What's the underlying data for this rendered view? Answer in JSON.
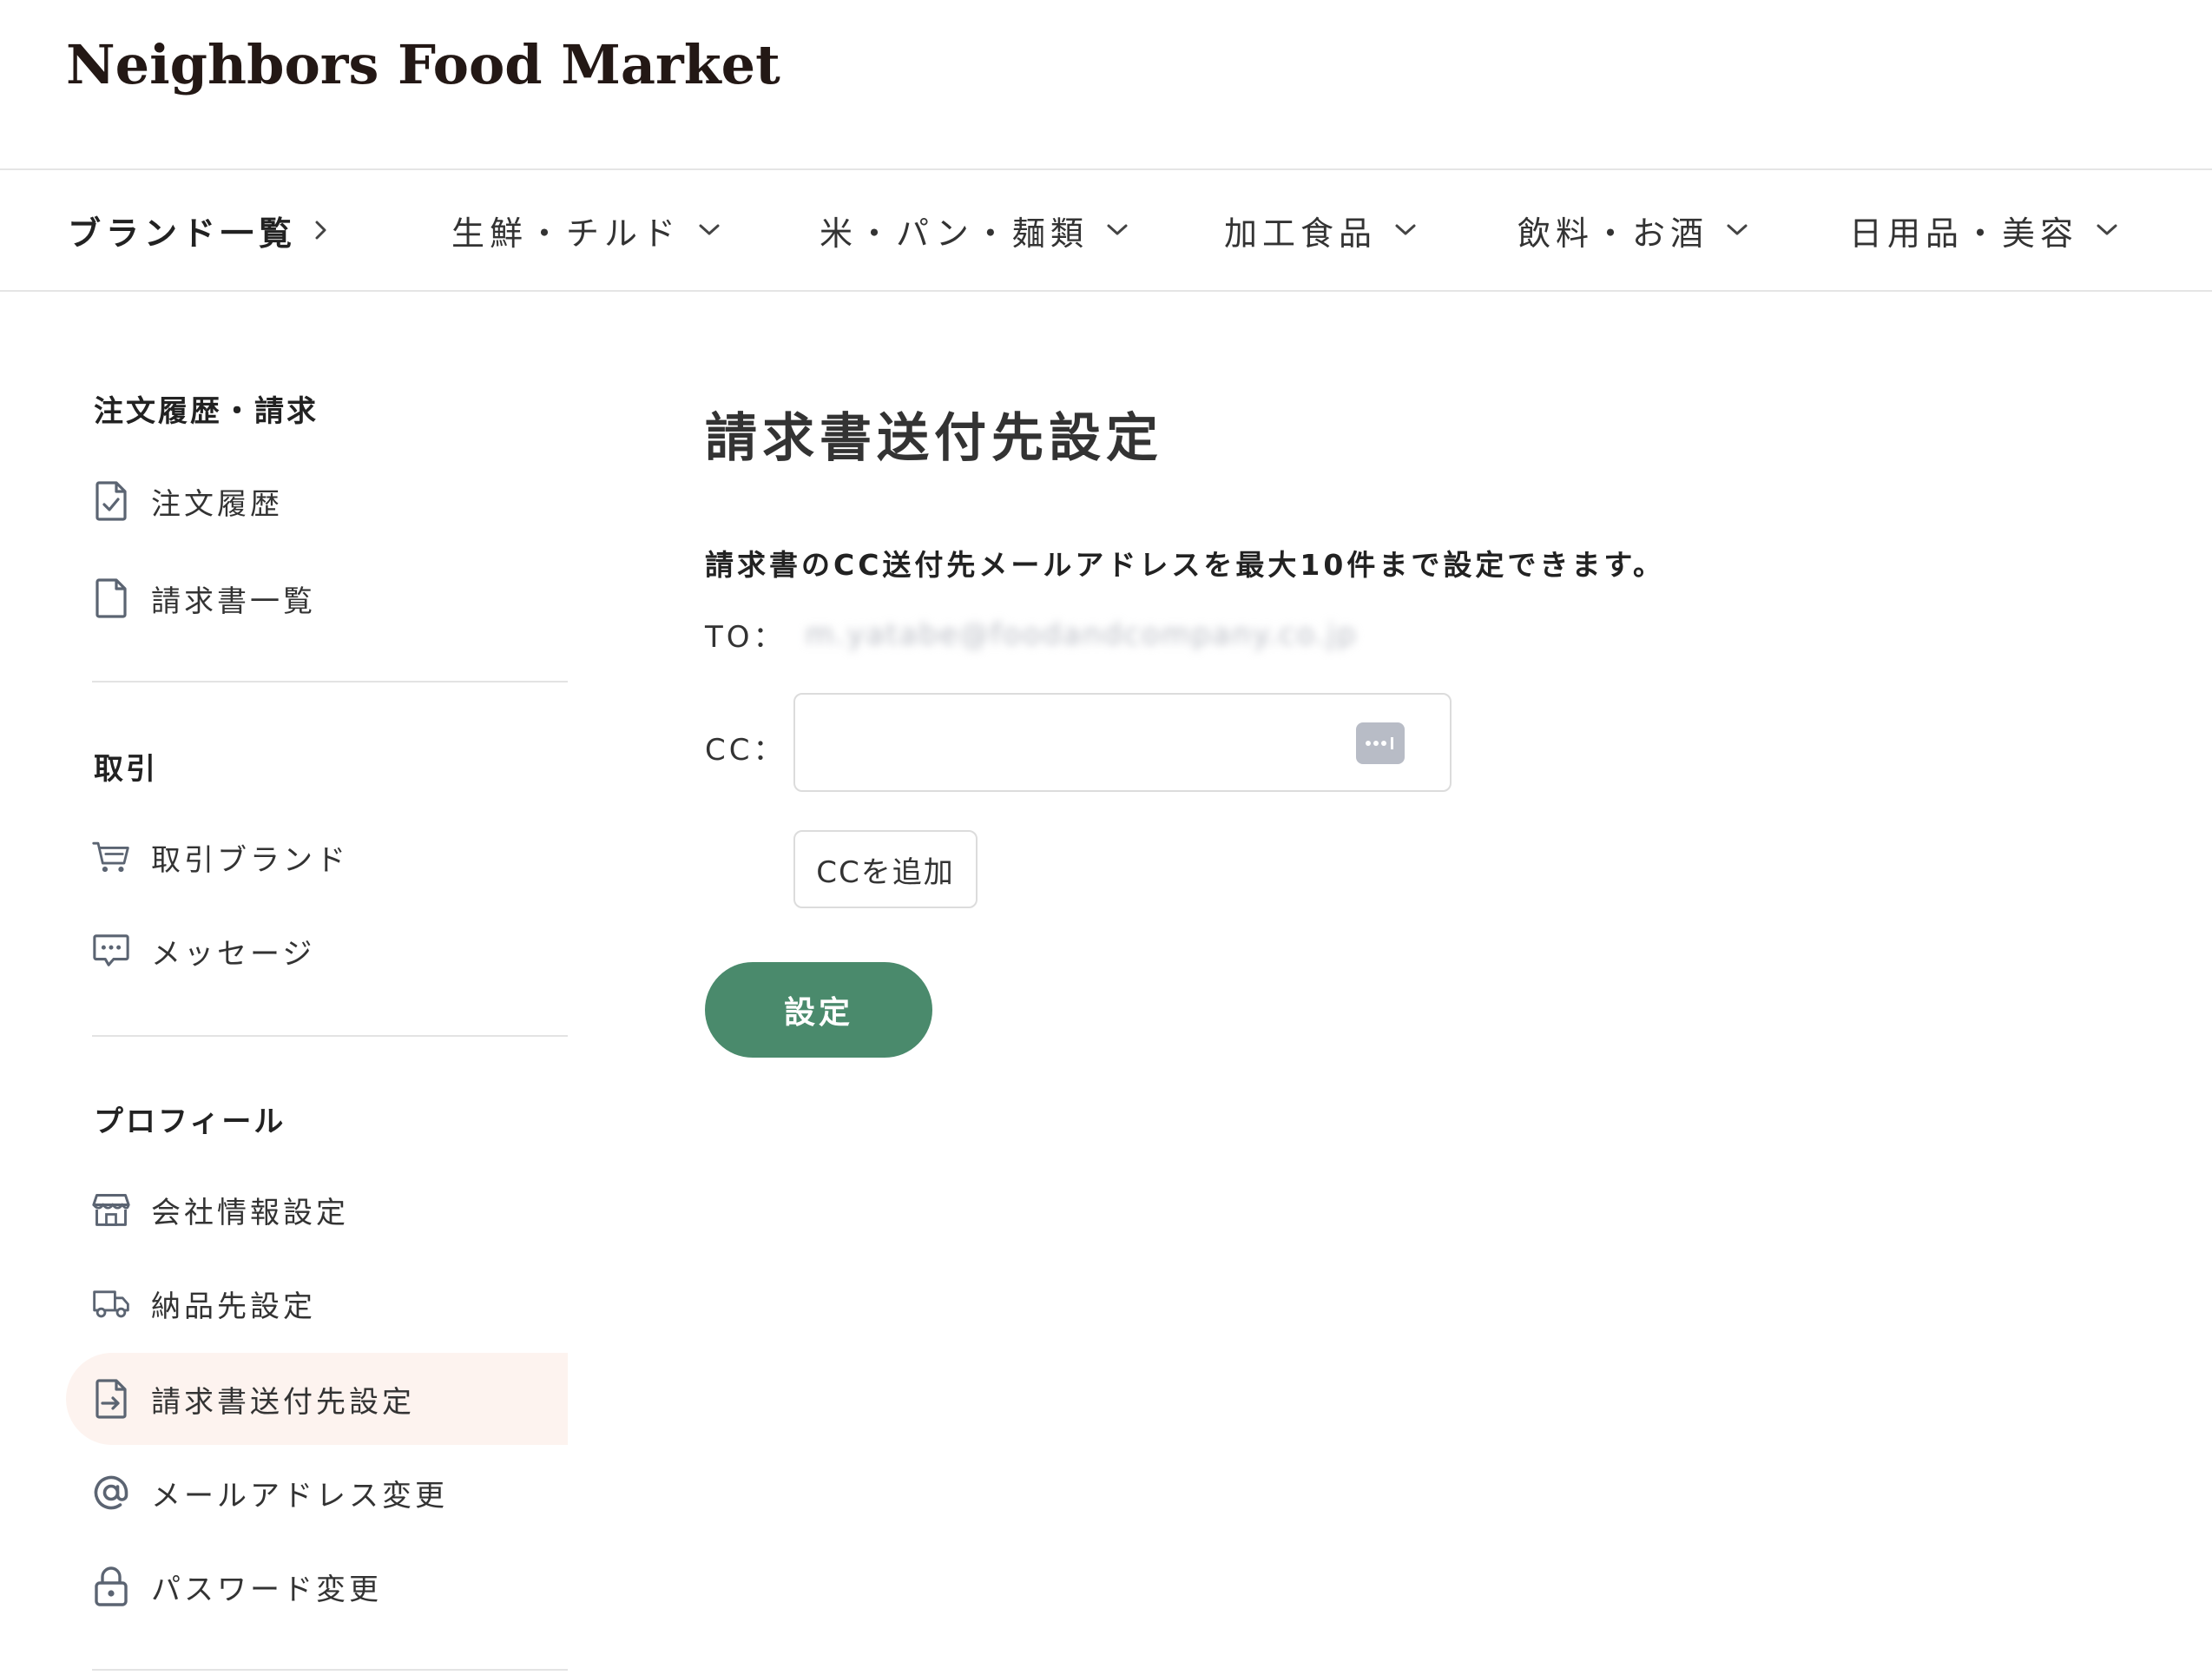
{
  "header": {
    "logo": "Neighbors Food Market"
  },
  "nav": {
    "items": [
      {
        "label": "ブランド一覧",
        "icon": "chevron-right-icon"
      },
      {
        "label": "生鮮・チルド",
        "icon": "chevron-down-icon"
      },
      {
        "label": "米・パン・麺類",
        "icon": "chevron-down-icon"
      },
      {
        "label": "加工食品",
        "icon": "chevron-down-icon"
      },
      {
        "label": "飲料・お酒",
        "icon": "chevron-down-icon"
      },
      {
        "label": "日用品・美容",
        "icon": "chevron-down-icon"
      }
    ]
  },
  "sidebar": {
    "sections": [
      {
        "title": "注文履歴・請求",
        "items": [
          {
            "label": "注文履歴",
            "icon": "document-check-icon"
          },
          {
            "label": "請求書一覧",
            "icon": "document-icon"
          }
        ]
      },
      {
        "title": "取引",
        "items": [
          {
            "label": "取引ブランド",
            "icon": "cart-icon"
          },
          {
            "label": "メッセージ",
            "icon": "message-icon"
          }
        ]
      },
      {
        "title": "プロフィール",
        "items": [
          {
            "label": "会社情報設定",
            "icon": "store-icon"
          },
          {
            "label": "納品先設定",
            "icon": "truck-icon"
          },
          {
            "label": "請求書送付先設定",
            "icon": "document-arrow-icon",
            "active": true
          },
          {
            "label": "メールアドレス変更",
            "icon": "at-icon"
          },
          {
            "label": "パスワード変更",
            "icon": "lock-icon"
          }
        ]
      }
    ]
  },
  "main": {
    "title": "請求書送付先設定",
    "description": "請求書のCC送付先メールアドレスを最大10件まで設定できます。",
    "to_label": "TO：",
    "to_email": "m.yatabe@foodandcompany.co.jp",
    "cc_label": "CC：",
    "cc_value": "",
    "add_cc_label": "CCを追加",
    "submit_label": "設定"
  },
  "colors": {
    "accent_green": "#4a8a6c",
    "active_bg": "#fdf3ef",
    "icon_slate": "#5b6472"
  }
}
